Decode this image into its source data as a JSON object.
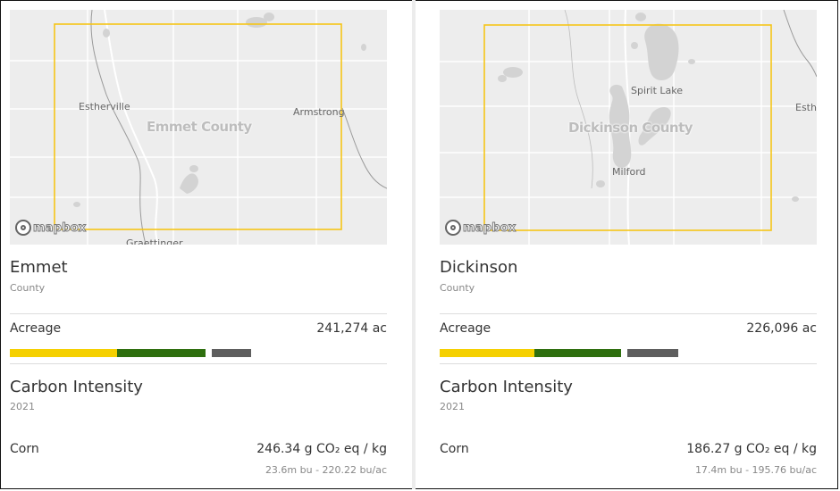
{
  "colors": {
    "county_outline": "#f5c518",
    "acreage_bar_yellow": "#f5d000",
    "acreage_bar_green": "#2e6f0f",
    "acreage_bar_gray": "#5e5e5e"
  },
  "cards": [
    {
      "map": {
        "county_label": "Emmet County",
        "places": [
          "Estherville",
          "Armstrong",
          "Graettinger"
        ],
        "attribution": "mapbox"
      },
      "name": "Emmet",
      "type": "County",
      "acreage": {
        "label": "Acreage",
        "value": "241,274 ac",
        "bar_fractions": {
          "yellow": 0.285,
          "green": 0.235,
          "gray": 0.105
        }
      },
      "carbon_intensity": {
        "title": "Carbon Intensity",
        "year": "2021",
        "crop": "Corn",
        "value": "246.34 g CO₂ eq / kg",
        "sub": "23.6m bu - 220.22 bu/ac"
      }
    },
    {
      "map": {
        "county_label": "Dickinson County",
        "places": [
          "Spirit Lake",
          "Milford",
          "Esth"
        ],
        "attribution": "mapbox"
      },
      "name": "Dickinson",
      "type": "County",
      "acreage": {
        "label": "Acreage",
        "value": "226,096 ac",
        "bar_fractions": {
          "yellow": 0.25,
          "green": 0.23,
          "gray": 0.135
        }
      },
      "carbon_intensity": {
        "title": "Carbon Intensity",
        "year": "2021",
        "crop": "Corn",
        "value": "186.27 g CO₂ eq / kg",
        "sub": "17.4m bu - 195.76 bu/ac"
      }
    }
  ]
}
